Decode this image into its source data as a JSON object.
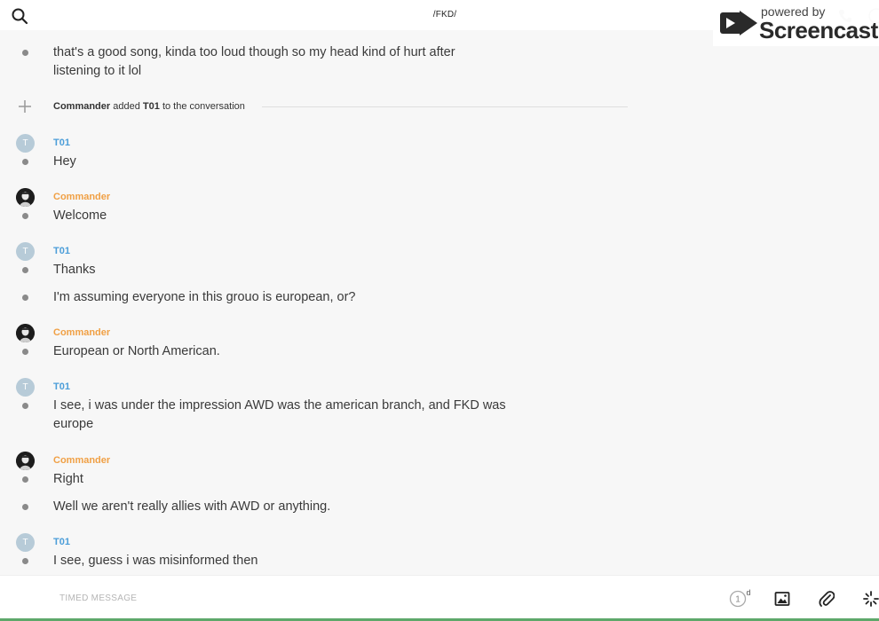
{
  "header": {
    "title": "/FKD/",
    "search_icon": "search-icon",
    "call_icon": "phone-icon",
    "info_icon": "info-icon"
  },
  "watermark": {
    "powered_text": "powered by",
    "brand_text": "Screencastify"
  },
  "system_message": {
    "actor": "Commander",
    "verb": "added",
    "target": "T01",
    "suffix": "to the conversation"
  },
  "messages": [
    {
      "text": "that's a good song, kinda too loud though so my head kind of hurt after listening to it lol"
    },
    {
      "author": "T01",
      "avatar_letter": "T",
      "text": "Hey"
    },
    {
      "author": "Commander",
      "text": "Welcome"
    },
    {
      "author": "T01",
      "avatar_letter": "T",
      "text": "Thanks"
    },
    {
      "text": "I'm assuming everyone in this grouo is european, or?"
    },
    {
      "author": "Commander",
      "text": "European or North American."
    },
    {
      "author": "T01",
      "avatar_letter": "T",
      "text": "I see, i was under the impression AWD was the american branch, and FKD was europe"
    },
    {
      "author": "Commander",
      "text": "Right"
    },
    {
      "text": "Well we aren't really allies with AWD or anything."
    },
    {
      "author": "T01",
      "avatar_letter": "T",
      "text": "I see, guess i was misinformed then"
    }
  ],
  "composer": {
    "placeholder": "TIMED MESSAGE",
    "timer_value": "1",
    "timer_unit": "d",
    "image_icon": "image-icon",
    "attach_icon": "paperclip-icon",
    "effects_icon": "sparkle-icon"
  },
  "colors": {
    "t01_name": "#4c9ed9",
    "commander_name": "#f0a045",
    "background": "#f7f7f7"
  }
}
